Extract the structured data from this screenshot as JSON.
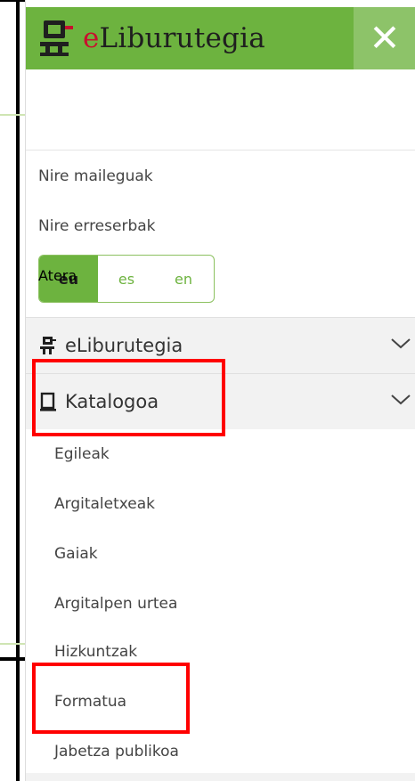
{
  "header": {
    "brand_e": "e",
    "brand_rest": "Liburutegia",
    "close_label": "✕"
  },
  "account_links": [
    "Nire maileguak",
    "Nire erreserbak"
  ],
  "logout_label": "Atera",
  "languages": {
    "active": "eu",
    "options": [
      "es",
      "en"
    ]
  },
  "sections": [
    {
      "label": "eLiburutegia",
      "icon": "robot-icon",
      "expanded": false
    },
    {
      "label": "Katalogoa",
      "icon": "book-icon",
      "expanded": true
    }
  ],
  "catalog_items": [
    "Egileak",
    "Argitaletxeak",
    "Gaiak",
    "Argitalpen urtea",
    "Hizkuntzak",
    "Formatua",
    "Jabetza publikoa"
  ],
  "colors": {
    "brand_green": "#6db33f",
    "highlight": "#ff0000"
  }
}
